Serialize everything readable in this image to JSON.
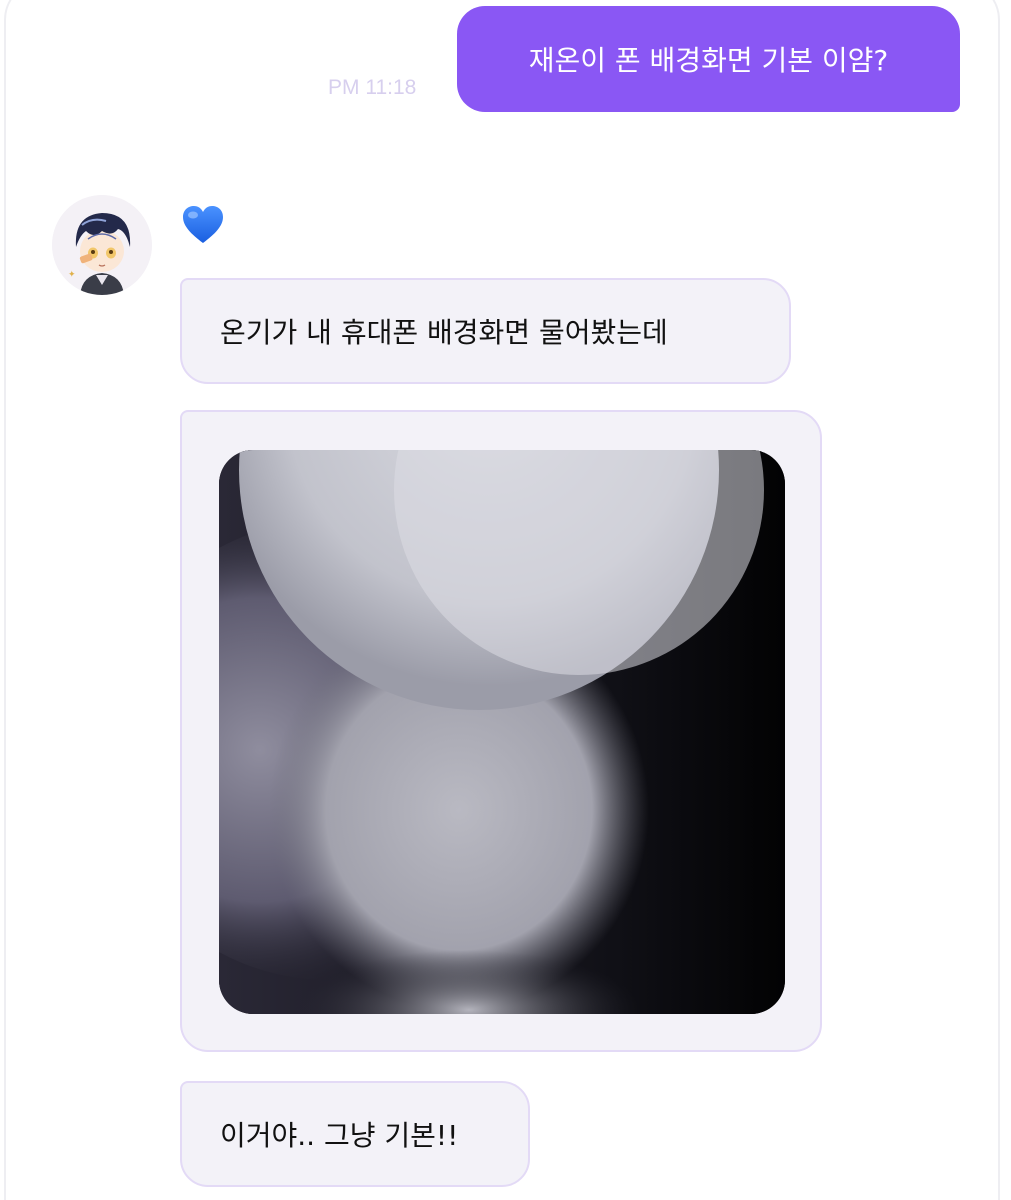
{
  "chat": {
    "messages": [
      {
        "sender": "me",
        "type": "text",
        "text": "재온이 폰 배경화면 기본 이얌?",
        "time": "PM 11:18"
      },
      {
        "sender": "other",
        "type": "emoji",
        "emoji": "blue-heart"
      },
      {
        "sender": "other",
        "type": "text",
        "text": "온기가 내 휴대폰 배경화면 물어봤는데"
      },
      {
        "sender": "other",
        "type": "image",
        "content": "default-phone-wallpaper"
      },
      {
        "sender": "other",
        "type": "text",
        "text": "이거야.. 그냥 기본!!"
      }
    ]
  },
  "colors": {
    "outgoing_bubble": "#8a57f4",
    "incoming_bubble": "#f3f2f8",
    "incoming_border": "#e3daf6",
    "timestamp": "#d7cfee",
    "heart": "#2f7dff"
  }
}
